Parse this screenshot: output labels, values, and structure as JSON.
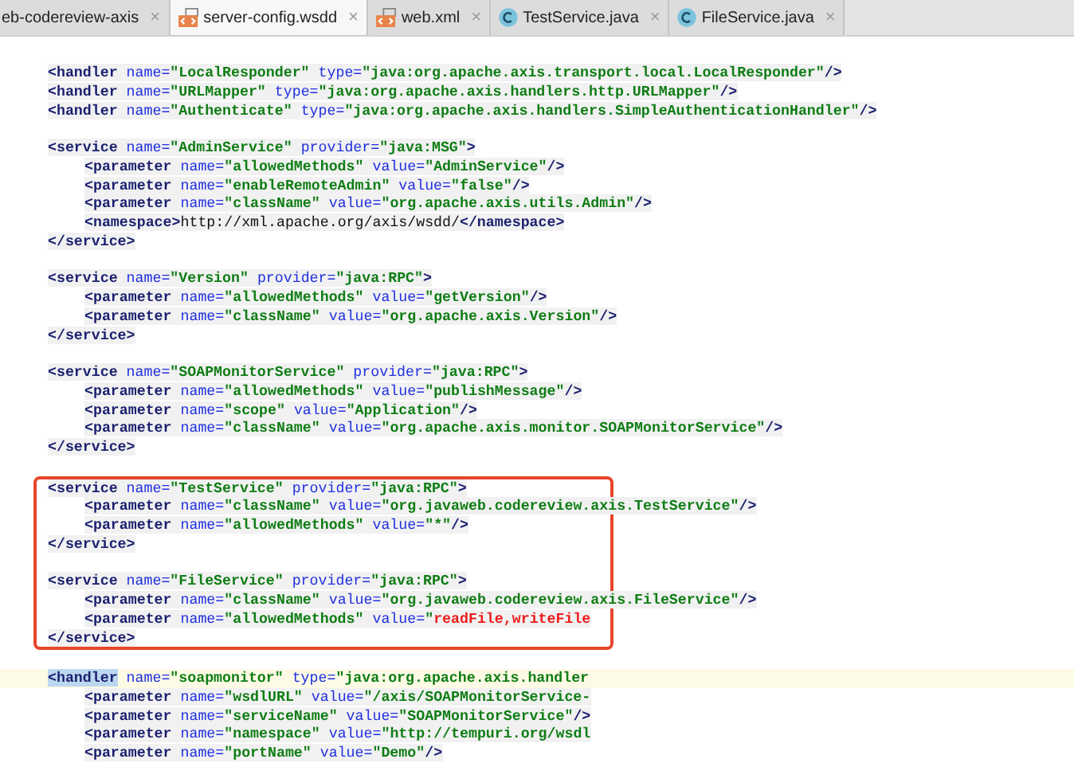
{
  "tabs": [
    {
      "label": "eb-codereview-axis",
      "kind": "none",
      "selected": false
    },
    {
      "label": "server-config.wsdd",
      "kind": "xml",
      "selected": true
    },
    {
      "label": "web.xml",
      "kind": "xml",
      "selected": false
    },
    {
      "label": "TestService.java",
      "kind": "class",
      "selected": false
    },
    {
      "label": "FileService.java",
      "kind": "class",
      "selected": false
    }
  ],
  "close_glyph": "×",
  "sections": [
    {
      "lines": [
        {
          "s": [
            {
              "kind": "tag",
              "text": "<handler"
            },
            {
              "kind": "attr",
              "text": " name="
            },
            {
              "kind": "value",
              "text": "\"LocalResponder\""
            },
            {
              "kind": "attr",
              "text": " type="
            },
            {
              "kind": "value",
              "text": "\"java:org.apache.axis.transport.local.LocalResponder\""
            },
            {
              "kind": "tag",
              "text": "/>"
            }
          ]
        },
        {
          "s": [
            {
              "kind": "tag",
              "text": "<handler"
            },
            {
              "kind": "attr",
              "text": " name="
            },
            {
              "kind": "value",
              "text": "\"URLMapper\""
            },
            {
              "kind": "attr",
              "text": " type="
            },
            {
              "kind": "value",
              "text": "\"java:org.apache.axis.handlers.http.URLMapper\""
            },
            {
              "kind": "tag",
              "text": "/>"
            }
          ]
        },
        {
          "s": [
            {
              "kind": "tag",
              "text": "<handler"
            },
            {
              "kind": "attr",
              "text": " name="
            },
            {
              "kind": "value",
              "text": "\"Authenticate\""
            },
            {
              "kind": "attr",
              "text": " type="
            },
            {
              "kind": "value",
              "text": "\"java:org.apache.axis.handlers.SimpleAuthenticationHandler\""
            },
            {
              "kind": "tag",
              "text": "/>"
            }
          ]
        }
      ]
    },
    {
      "lines": [
        {
          "s": [
            {
              "kind": "tag",
              "text": "<service"
            },
            {
              "kind": "attr",
              "text": " name="
            },
            {
              "kind": "value",
              "text": "\"AdminService\""
            },
            {
              "kind": "attr",
              "text": " provider="
            },
            {
              "kind": "value",
              "text": "\"java:MSG\""
            },
            {
              "kind": "tag",
              "text": ">"
            }
          ]
        },
        {
          "indent": true,
          "s": [
            {
              "kind": "tag",
              "text": "<parameter"
            },
            {
              "kind": "attr",
              "text": " name="
            },
            {
              "kind": "value",
              "text": "\"allowedMethods\""
            },
            {
              "kind": "attr",
              "text": " value="
            },
            {
              "kind": "value",
              "text": "\"AdminService\""
            },
            {
              "kind": "tag",
              "text": "/>"
            }
          ]
        },
        {
          "indent": true,
          "s": [
            {
              "kind": "tag",
              "text": "<parameter"
            },
            {
              "kind": "attr",
              "text": " name="
            },
            {
              "kind": "value",
              "text": "\"enableRemoteAdmin\""
            },
            {
              "kind": "attr",
              "text": " value="
            },
            {
              "kind": "value",
              "text": "\"false\""
            },
            {
              "kind": "tag",
              "text": "/>"
            }
          ]
        },
        {
          "indent": true,
          "s": [
            {
              "kind": "tag",
              "text": "<parameter"
            },
            {
              "kind": "attr",
              "text": " name="
            },
            {
              "kind": "value",
              "text": "\"className\""
            },
            {
              "kind": "attr",
              "text": " value="
            },
            {
              "kind": "value",
              "text": "\"org.apache.axis.utils.Admin\""
            },
            {
              "kind": "tag",
              "text": "/>"
            }
          ]
        },
        {
          "indent": true,
          "s": [
            {
              "kind": "tag",
              "text": "<namespace>"
            },
            {
              "kind": "text",
              "text": "http://xml.apache.org/axis/wsdd/"
            },
            {
              "kind": "tag",
              "text": "</namespace>"
            }
          ]
        },
        {
          "s": [
            {
              "kind": "tag",
              "text": "</service>"
            }
          ]
        }
      ]
    },
    {
      "lines": [
        {
          "s": [
            {
              "kind": "tag",
              "text": "<service"
            },
            {
              "kind": "attr",
              "text": " name="
            },
            {
              "kind": "value",
              "text": "\"Version\""
            },
            {
              "kind": "attr",
              "text": " provider="
            },
            {
              "kind": "value",
              "text": "\"java:RPC\""
            },
            {
              "kind": "tag",
              "text": ">"
            }
          ]
        },
        {
          "indent": true,
          "s": [
            {
              "kind": "tag",
              "text": "<parameter"
            },
            {
              "kind": "attr",
              "text": " name="
            },
            {
              "kind": "value",
              "text": "\"allowedMethods\""
            },
            {
              "kind": "attr",
              "text": " value="
            },
            {
              "kind": "value",
              "text": "\"getVersion\""
            },
            {
              "kind": "tag",
              "text": "/>"
            }
          ]
        },
        {
          "indent": true,
          "s": [
            {
              "kind": "tag",
              "text": "<parameter"
            },
            {
              "kind": "attr",
              "text": " name="
            },
            {
              "kind": "value",
              "text": "\"className\""
            },
            {
              "kind": "attr",
              "text": " value="
            },
            {
              "kind": "value",
              "text": "\"org.apache.axis.Version\""
            },
            {
              "kind": "tag",
              "text": "/>"
            }
          ]
        },
        {
          "s": [
            {
              "kind": "tag",
              "text": "</service>"
            }
          ]
        }
      ]
    },
    {
      "lines": [
        {
          "s": [
            {
              "kind": "tag",
              "text": "<service"
            },
            {
              "kind": "attr",
              "text": " name="
            },
            {
              "kind": "value",
              "text": "\"SOAPMonitorService\""
            },
            {
              "kind": "attr",
              "text": " provider="
            },
            {
              "kind": "value",
              "text": "\"java:RPC\""
            },
            {
              "kind": "tag",
              "text": ">"
            }
          ]
        },
        {
          "indent": true,
          "s": [
            {
              "kind": "tag",
              "text": "<parameter"
            },
            {
              "kind": "attr",
              "text": " name="
            },
            {
              "kind": "value",
              "text": "\"allowedMethods\""
            },
            {
              "kind": "attr",
              "text": " value="
            },
            {
              "kind": "value",
              "text": "\"publishMessage\""
            },
            {
              "kind": "tag",
              "text": "/>"
            }
          ]
        },
        {
          "indent": true,
          "s": [
            {
              "kind": "tag",
              "text": "<parameter"
            },
            {
              "kind": "attr",
              "text": " name="
            },
            {
              "kind": "value",
              "text": "\"scope\""
            },
            {
              "kind": "attr",
              "text": " value="
            },
            {
              "kind": "value",
              "text": "\"Application\""
            },
            {
              "kind": "tag",
              "text": "/>"
            }
          ]
        },
        {
          "indent": true,
          "s": [
            {
              "kind": "tag",
              "text": "<parameter"
            },
            {
              "kind": "attr",
              "text": " name="
            },
            {
              "kind": "value",
              "text": "\"className\""
            },
            {
              "kind": "attr",
              "text": " value="
            },
            {
              "kind": "value",
              "text": "\"org.apache.axis.monitor.SOAPMonitorService\""
            },
            {
              "kind": "tag",
              "text": "/>"
            }
          ]
        },
        {
          "s": [
            {
              "kind": "tag",
              "text": "</service>"
            }
          ]
        }
      ]
    },
    {
      "boxed": true,
      "lines": [
        {
          "s": [
            {
              "kind": "tag",
              "text": "<service"
            },
            {
              "kind": "attr",
              "text": " name="
            },
            {
              "kind": "value",
              "text": "\"TestService\""
            },
            {
              "kind": "attr",
              "text": " provider="
            },
            {
              "kind": "value",
              "text": "\"java:RPC\""
            },
            {
              "kind": "tag",
              "text": ">"
            }
          ]
        },
        {
          "indent": true,
          "s": [
            {
              "kind": "tag",
              "text": "<parameter"
            },
            {
              "kind": "attr",
              "text": " name="
            },
            {
              "kind": "value",
              "text": "\"className\""
            },
            {
              "kind": "attr",
              "text": " value="
            },
            {
              "kind": "value",
              "text": "\"org.javaweb.codereview.axis.TestService\""
            },
            {
              "kind": "tag",
              "text": "/>"
            }
          ]
        },
        {
          "indent": true,
          "s": [
            {
              "kind": "tag",
              "text": "<parameter"
            },
            {
              "kind": "attr",
              "text": " name="
            },
            {
              "kind": "value",
              "text": "\"allowedMethods\""
            },
            {
              "kind": "attr",
              "text": " value="
            },
            {
              "kind": "value",
              "text": "\"*\""
            },
            {
              "kind": "tag",
              "text": "/>"
            }
          ]
        },
        {
          "s": [
            {
              "kind": "tag",
              "text": "</service>"
            }
          ]
        }
      ]
    },
    {
      "boxed": true,
      "lines": [
        {
          "s": [
            {
              "kind": "tag",
              "text": "<service"
            },
            {
              "kind": "attr",
              "text": " name="
            },
            {
              "kind": "value",
              "text": "\"FileService\""
            },
            {
              "kind": "attr",
              "text": " provider="
            },
            {
              "kind": "value",
              "text": "\"java:RPC\""
            },
            {
              "kind": "tag",
              "text": ">"
            }
          ]
        },
        {
          "indent": true,
          "s": [
            {
              "kind": "tag",
              "text": "<parameter"
            },
            {
              "kind": "attr",
              "text": " name="
            },
            {
              "kind": "value",
              "text": "\"className\""
            },
            {
              "kind": "attr",
              "text": " value="
            },
            {
              "kind": "value",
              "text": "\"org.javaweb.codereview.axis.FileService\""
            },
            {
              "kind": "tag",
              "text": "/>"
            }
          ]
        },
        {
          "indent": true,
          "s": [
            {
              "kind": "tag",
              "text": "<parameter"
            },
            {
              "kind": "attr",
              "text": " name="
            },
            {
              "kind": "value",
              "text": "\"allowedMethods\""
            },
            {
              "kind": "attr",
              "text": " value="
            },
            {
              "kind": "value",
              "text": "\""
            },
            {
              "kind": "marked",
              "text": "readFile,writeFile"
            }
          ]
        },
        {
          "s": [
            {
              "kind": "tag",
              "text": "</service>"
            }
          ]
        }
      ]
    },
    {
      "lines": [
        {
          "current": true,
          "s": [
            {
              "kind": "selected",
              "text": "<handler"
            },
            {
              "kind": "attr",
              "text": " name="
            },
            {
              "kind": "value",
              "text": "\"soapmonitor\""
            },
            {
              "kind": "attr",
              "text": " type="
            },
            {
              "kind": "value",
              "text": "\"java:org.apache.axis.handler"
            }
          ]
        },
        {
          "indent": true,
          "s": [
            {
              "kind": "tag",
              "text": "<parameter"
            },
            {
              "kind": "attr",
              "text": " name="
            },
            {
              "kind": "value",
              "text": "\"wsdlURL\""
            },
            {
              "kind": "attr",
              "text": " value="
            },
            {
              "kind": "value",
              "text": "\"/axis/SOAPMonitorService-"
            }
          ]
        },
        {
          "indent": true,
          "s": [
            {
              "kind": "tag",
              "text": "<parameter"
            },
            {
              "kind": "attr",
              "text": " name="
            },
            {
              "kind": "value",
              "text": "\"serviceName\""
            },
            {
              "kind": "attr",
              "text": " value="
            },
            {
              "kind": "value",
              "text": "\"SOAPMonitorService\""
            },
            {
              "kind": "tag",
              "text": "/>"
            }
          ]
        },
        {
          "indent": true,
          "s": [
            {
              "kind": "tag",
              "text": "<parameter"
            },
            {
              "kind": "attr",
              "text": " name="
            },
            {
              "kind": "value",
              "text": "\"namespace\""
            },
            {
              "kind": "attr",
              "text": " value="
            },
            {
              "kind": "value",
              "text": "\"http://tempuri.org/wsdl"
            }
          ]
        },
        {
          "indent": true,
          "s": [
            {
              "kind": "tag",
              "text": "<parameter"
            },
            {
              "kind": "attr",
              "text": " name="
            },
            {
              "kind": "value",
              "text": "\"portName\""
            },
            {
              "kind": "attr",
              "text": " value="
            },
            {
              "kind": "value",
              "text": "\"Demo\""
            },
            {
              "kind": "tag",
              "text": "/>"
            }
          ]
        }
      ]
    }
  ]
}
